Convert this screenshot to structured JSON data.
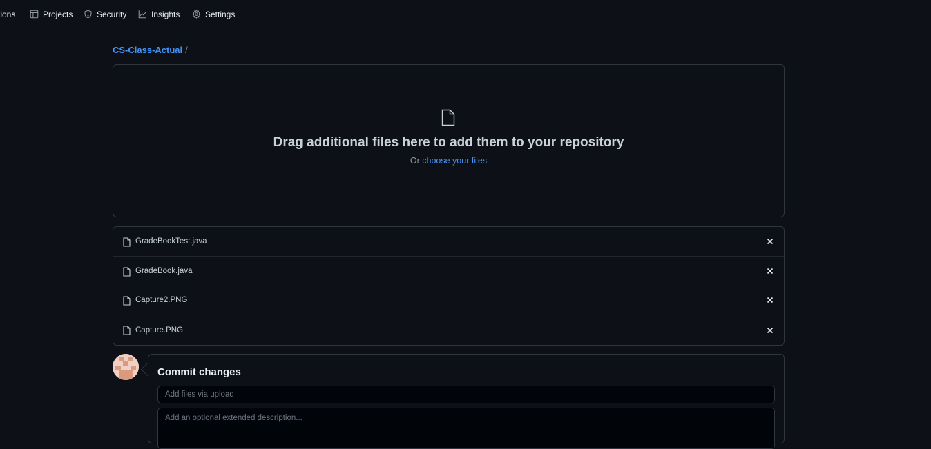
{
  "nav": {
    "items": [
      {
        "label": "tions",
        "icon": "none"
      },
      {
        "label": "Projects",
        "icon": "table-icon"
      },
      {
        "label": "Security",
        "icon": "shield-icon"
      },
      {
        "label": "Insights",
        "icon": "graph-icon"
      },
      {
        "label": "Settings",
        "icon": "gear-icon"
      }
    ]
  },
  "breadcrumb": {
    "repo": "CS-Class-Actual",
    "separator": "/"
  },
  "dropzone": {
    "title": "Drag additional files here to add them to your repository",
    "prefix": "Or",
    "link": "choose your files"
  },
  "files": [
    {
      "name": "GradeBookTest.java"
    },
    {
      "name": "GradeBook.java"
    },
    {
      "name": "Capture2.PNG"
    },
    {
      "name": "Capture.PNG"
    }
  ],
  "commit": {
    "title": "Commit changes",
    "summary_placeholder": "Add files via upload",
    "description_placeholder": "Add an optional extended description..."
  },
  "colors": {
    "background": "#0d1117",
    "border": "#30363d",
    "link": "#4493f8",
    "text": "#e6edf3",
    "muted": "#9198a1"
  }
}
